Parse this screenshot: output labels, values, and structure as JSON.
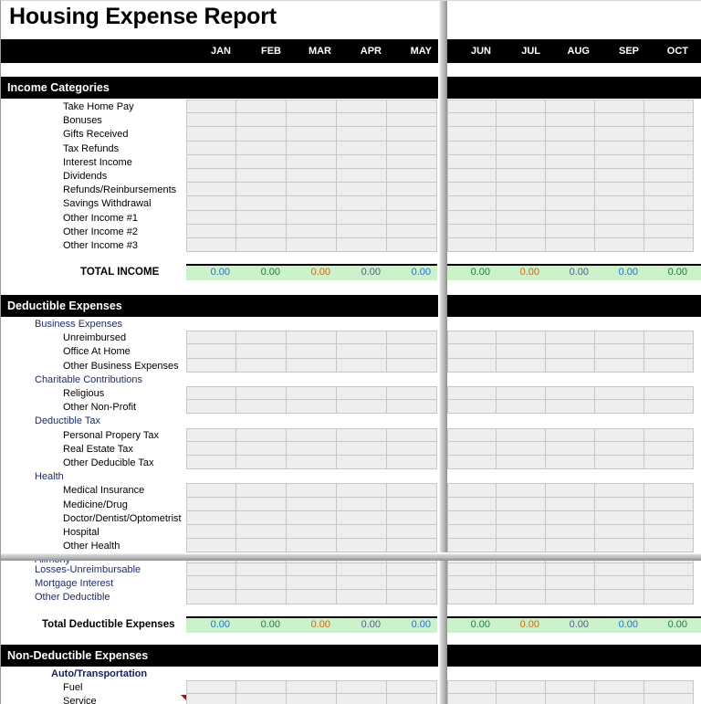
{
  "document": {
    "title": "Housing Expense Report"
  },
  "columns": {
    "left_months": [
      "JAN",
      "FEB",
      "MAR",
      "APR",
      "MAY"
    ],
    "right_months": [
      "JUN",
      "JUL",
      "AUG",
      "SEP",
      "OCT"
    ]
  },
  "sections": {
    "income": {
      "header": "Income Categories",
      "rows": [
        "Take Home Pay",
        "Bonuses",
        "Gifts Received",
        "Tax Refunds",
        "Interest Income",
        "Dividends",
        "Refunds/Reinbursements",
        "Savings Withdrawal",
        "Other Income #1",
        "Other Income #2",
        "Other Income #3"
      ],
      "total_label": "TOTAL INCOME",
      "total_left": [
        "0.00",
        "0.00",
        "0.00",
        "0.00",
        "0.00"
      ],
      "total_right": [
        "0.00",
        "0.00",
        "0.00",
        "0.00",
        "0.00"
      ]
    },
    "deductible": {
      "header": "Deductible Expenses",
      "rows": [
        {
          "label": "Business Expenses",
          "style": "cat",
          "cells": false
        },
        {
          "label": "Unreimbursed",
          "style": "sub",
          "cells": true
        },
        {
          "label": "Office At Home",
          "style": "sub",
          "cells": true
        },
        {
          "label": "Other Business Expenses",
          "style": "sub",
          "cells": true
        },
        {
          "label": "Charitable Contributions",
          "style": "cat",
          "cells": false
        },
        {
          "label": "Religious",
          "style": "sub",
          "cells": true
        },
        {
          "label": "Other Non-Profit",
          "style": "sub",
          "cells": true
        },
        {
          "label": "Deductible Tax",
          "style": "cat",
          "cells": false
        },
        {
          "label": "Personal Propery Tax",
          "style": "sub",
          "cells": true
        },
        {
          "label": "Real Estate Tax",
          "style": "sub",
          "cells": true
        },
        {
          "label": "Other Deducible Tax",
          "style": "sub",
          "cells": true
        },
        {
          "label": "Health",
          "style": "cat",
          "cells": false
        },
        {
          "label": "Medical Insurance",
          "style": "sub",
          "cells": true
        },
        {
          "label": "Medicine/Drug",
          "style": "sub",
          "cells": true
        },
        {
          "label": "Doctor/Dentist/Optometrist",
          "style": "sub",
          "cells": true
        },
        {
          "label": "Hospital",
          "style": "sub",
          "cells": true
        },
        {
          "label": "Other Health",
          "style": "sub",
          "cells": true
        },
        {
          "label": "Alimony",
          "style": "cat",
          "cells": true
        }
      ],
      "rows_below_split": [
        {
          "label": "Losses-Unreimbursable",
          "style": "cat",
          "cells": true
        },
        {
          "label": "Mortgage Interest",
          "style": "cat",
          "cells": true
        },
        {
          "label": "Other Deductible",
          "style": "cat",
          "cells": true
        }
      ],
      "total_label": "Total Deductible Expenses",
      "total_left": [
        "0.00",
        "0.00",
        "0.00",
        "0.00",
        "0.00"
      ],
      "total_right": [
        "0.00",
        "0.00",
        "0.00",
        "0.00",
        "0.00"
      ]
    },
    "nondeductible": {
      "header": "Non-Deductible Expenses",
      "rows": [
        {
          "label": "Auto/Transportation",
          "style": "catb",
          "cells": false
        },
        {
          "label": "Fuel",
          "style": "sub",
          "cells": true
        },
        {
          "label": "Service",
          "style": "sub",
          "cells": true,
          "comment": true
        }
      ]
    }
  },
  "value_colors": {
    "left": [
      "#2a6fc4",
      "#1f7a43",
      "#cc6611",
      "#5a5a8a",
      "#2a6fc4"
    ],
    "right": [
      "#1f7a43",
      "#cc6611",
      "#5a5a8a",
      "#2a6fc4",
      "#1f7a43"
    ]
  }
}
